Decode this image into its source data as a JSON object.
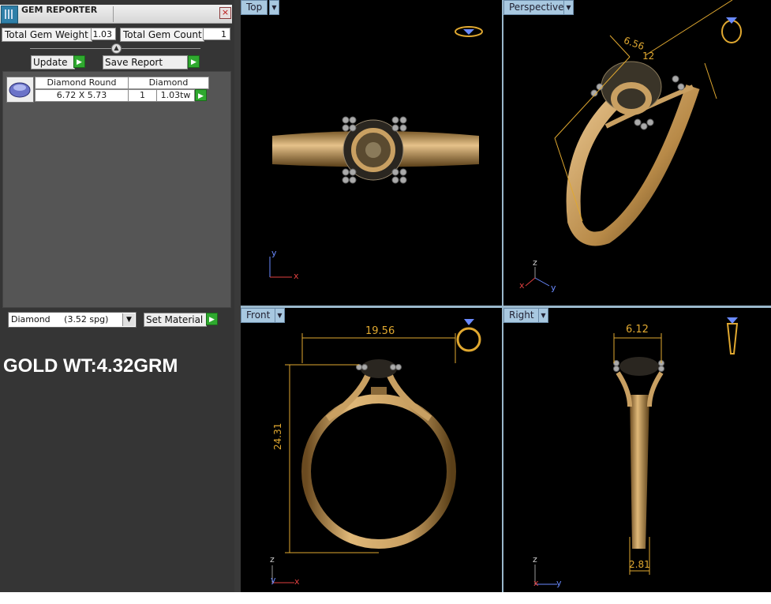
{
  "panel": {
    "title": "GEM REPORTER",
    "total_weight_label": "Total Gem Weight",
    "total_weight_value": "1.03",
    "total_count_label": "Total Gem Count",
    "total_count_value": "1",
    "update_label": "Update",
    "save_label": "Save Report",
    "gem_row": {
      "shape_header": "Diamond Round",
      "material_header": "Diamond",
      "size": "6.72 X 5.73",
      "count": "1",
      "weight": "1.03tw"
    },
    "material_select": "Diamond     (3.52 spg)",
    "set_material_label": "Set Material"
  },
  "note": "GOLD WT:4.32GRM",
  "viewports": {
    "top": {
      "label": "Top",
      "axis_y": "y",
      "axis_x": "x"
    },
    "perspective": {
      "label": "Perspective",
      "dim_a": "6.56",
      "dim_b": "12",
      "axis_z": "z",
      "axis_x": "x",
      "axis_y": "y"
    },
    "front": {
      "label": "Front",
      "width_dim": "19.56",
      "height_dim": "24.31",
      "axis_z": "z",
      "axis_y": "y",
      "axis_x": "x"
    },
    "right": {
      "label": "Right",
      "width_dim": "6.12",
      "shank_dim": "2.81",
      "axis_z": "z",
      "axis_x": "x",
      "axis_y": "y"
    }
  },
  "colors": {
    "gold": "#c9a062",
    "dimension": "#e0a830",
    "axis_y": "#6a8aff",
    "axis_x": "#e04040",
    "viewport_label": "#a8c8e0"
  }
}
